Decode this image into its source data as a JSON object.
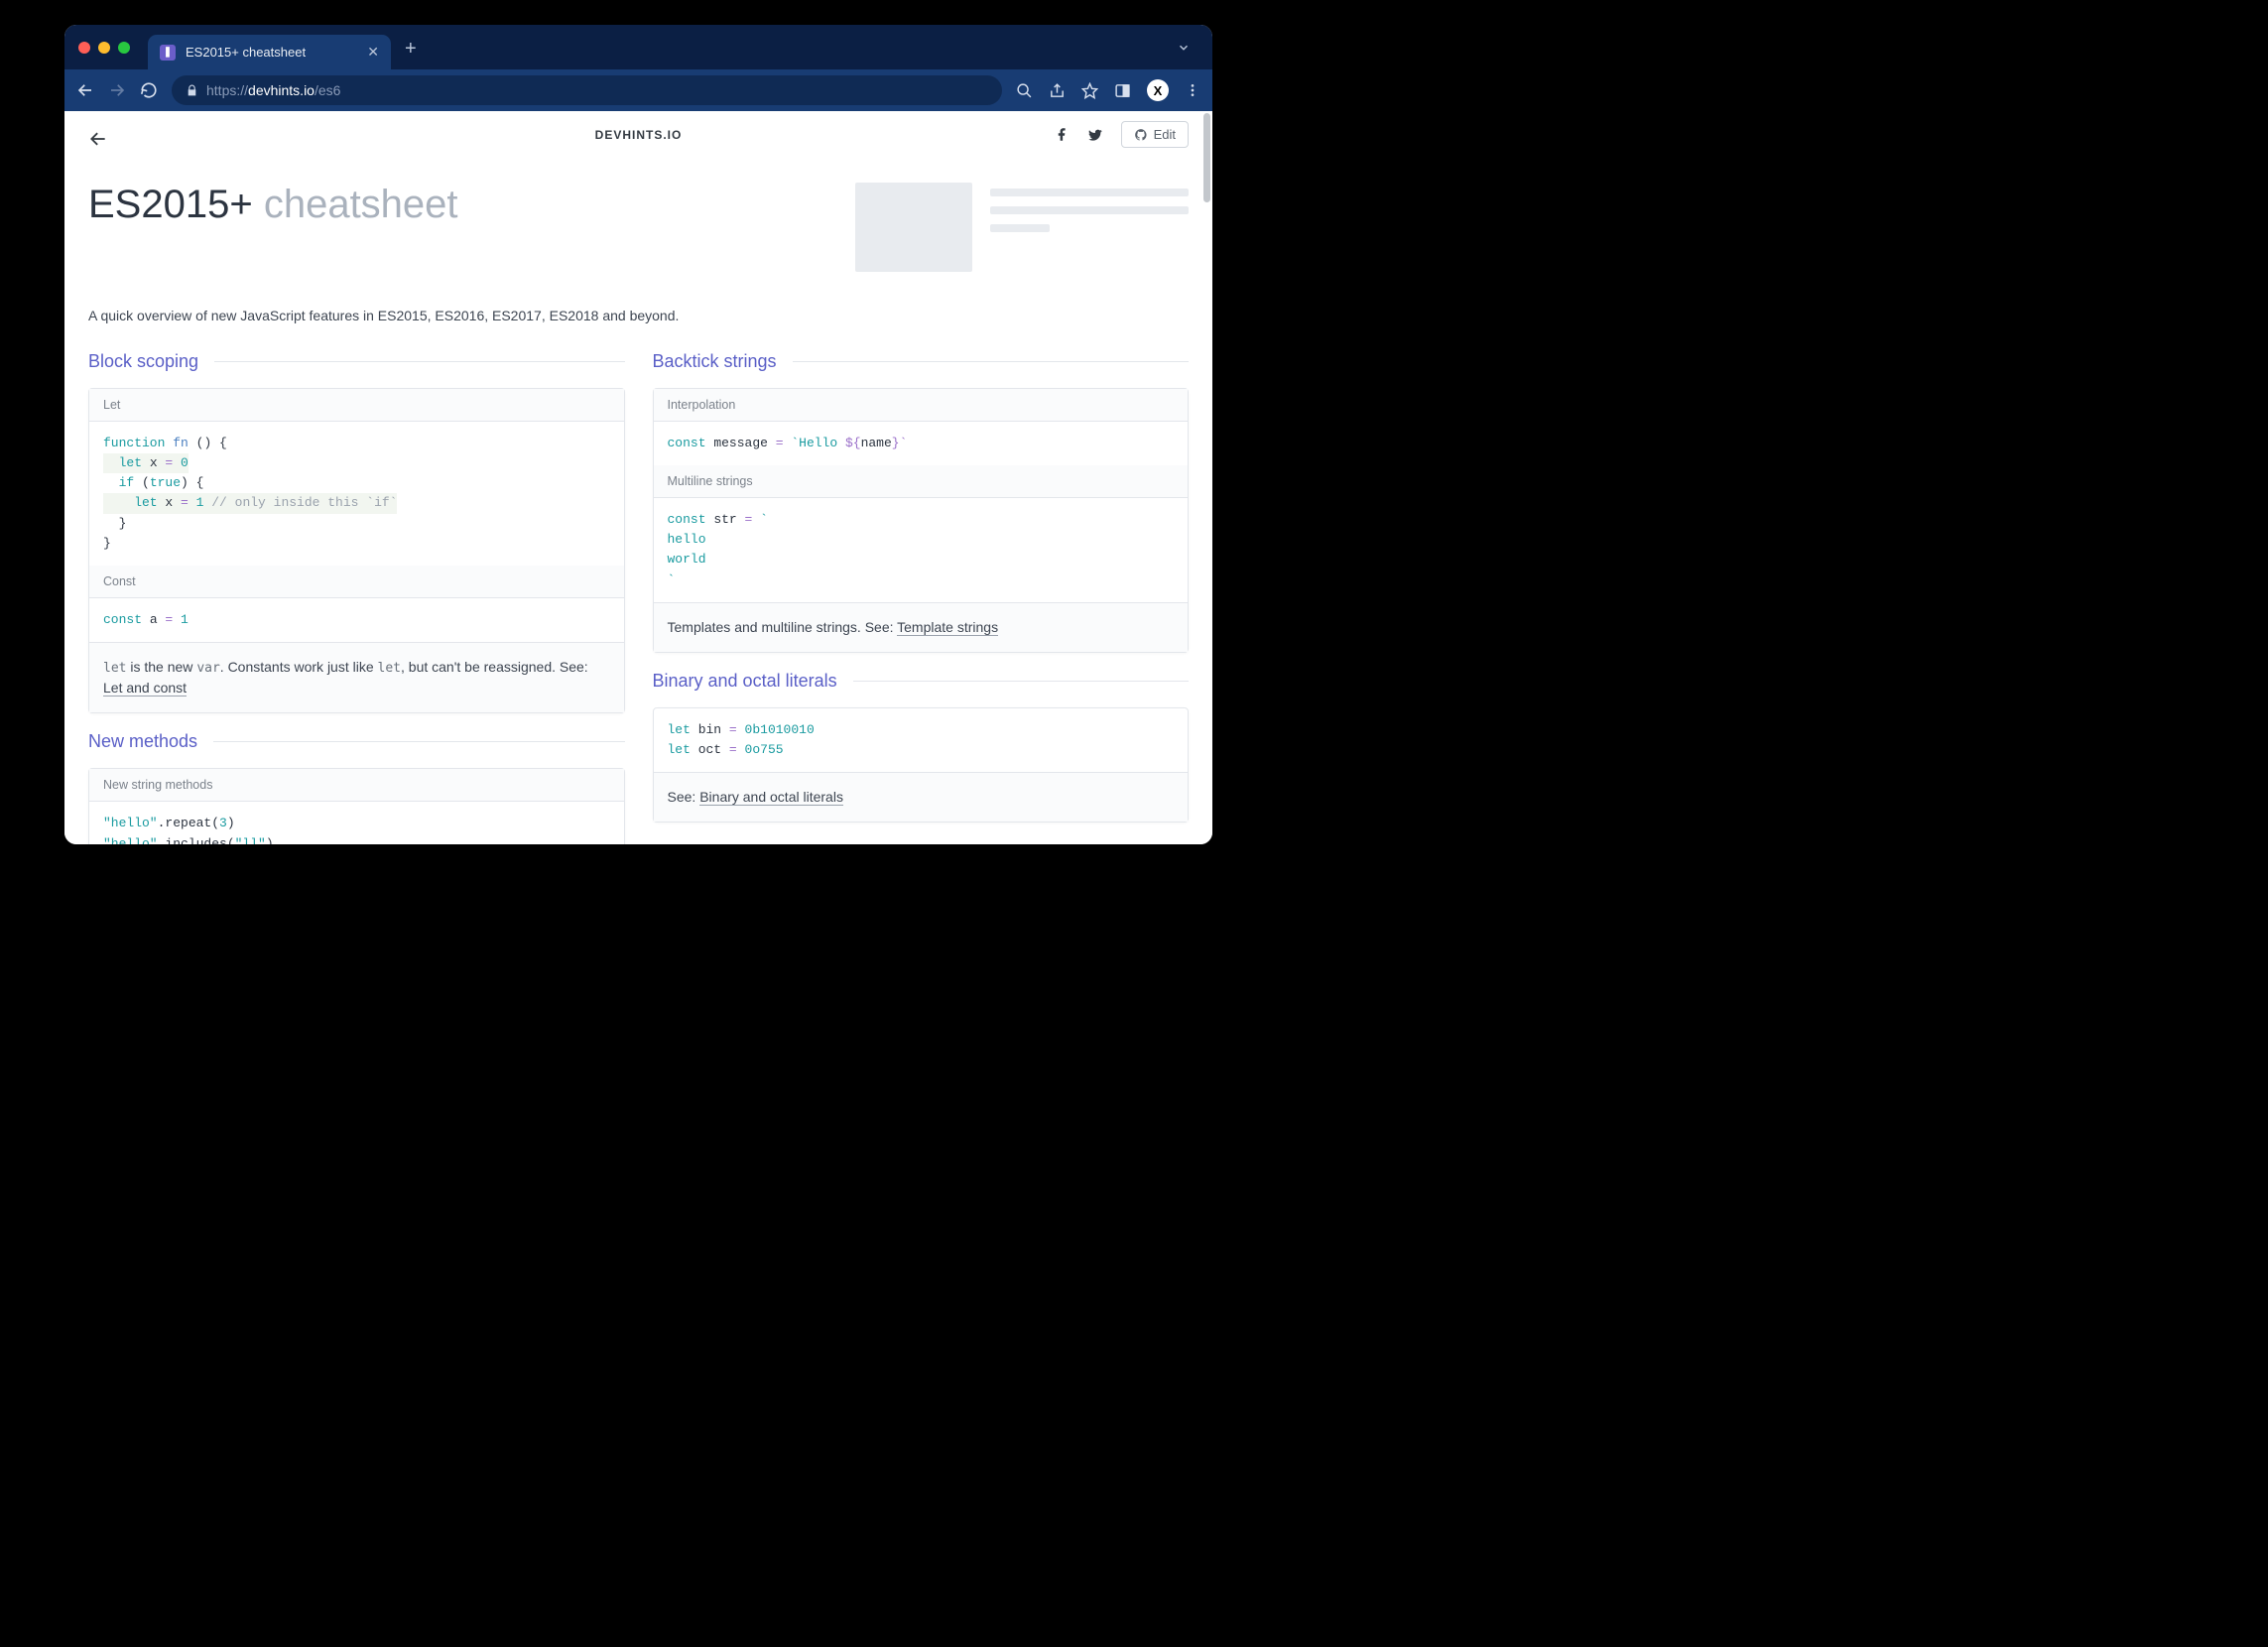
{
  "browser": {
    "tab_title": "ES2015+ cheatsheet",
    "url_prefix": "https://",
    "url_host": "devhints.io",
    "url_path": "/es6",
    "avatar_letter": "X"
  },
  "header": {
    "brand": "DEVHINTS.IO",
    "edit_label": "Edit"
  },
  "hero": {
    "title_main": "ES2015+",
    "title_sub": "cheatsheet",
    "subtitle": "A quick overview of new JavaScript features in ES2015, ES2016, ES2017, ES2018 and beyond."
  },
  "sections": {
    "block_scoping": {
      "title": "Block scoping",
      "let_header": "Let",
      "let_code": {
        "l1a": "function",
        "l1b": "fn",
        "l1c": " () {",
        "l2a": "  let",
        "l2b": " x ",
        "l2c": "=",
        "l2d": " 0",
        "l3a": "  if",
        "l3b": " (",
        "l3c": "true",
        "l3d": ") {",
        "l4a": "    let",
        "l4b": " x ",
        "l4c": "=",
        "l4d": " 1",
        "l4e": " // only inside this `if`",
        "l5": "  }",
        "l6": "}"
      },
      "const_header": "Const",
      "const_code": {
        "a": "const",
        "b": " a ",
        "c": "=",
        "d": " 1"
      },
      "note_pre": "let",
      "note_mid1": " is the new ",
      "note_var": "var",
      "note_mid2": ". Constants work just like ",
      "note_let": "let",
      "note_mid3": ", but can't be reassigned. See: ",
      "note_link": "Let and const"
    },
    "new_methods": {
      "title": "New methods",
      "string_header": "New string methods",
      "code": {
        "l1a": "\"hello\"",
        "l1b": ".repeat(",
        "l1c": "3",
        "l1d": ")",
        "l2a": "\"hello\"",
        "l2b": ".includes(",
        "l2c": "\"ll\"",
        "l2d": ")"
      }
    },
    "backtick": {
      "title": "Backtick strings",
      "interp_header": "Interpolation",
      "interp_code": {
        "a": "const",
        "b": " message ",
        "c": "=",
        "d": " `Hello ",
        "e": "${",
        "f": "name",
        "g": "}`"
      },
      "multi_header": "Multiline strings",
      "multi_code": {
        "l1a": "const",
        "l1b": " str ",
        "l1c": "=",
        "l1d": " `",
        "l2": "hello",
        "l3": "world",
        "l4": "`"
      },
      "note_pre": "Templates and multiline strings. See: ",
      "note_link": "Template strings"
    },
    "binary": {
      "title": "Binary and octal literals",
      "code": {
        "l1a": "let",
        "l1b": " bin ",
        "l1c": "=",
        "l1d": " 0b1010010",
        "l2a": "let",
        "l2b": " oct ",
        "l2c": "=",
        "l2d": " 0o755"
      },
      "note_pre": "See: ",
      "note_link": "Binary and octal literals"
    }
  }
}
